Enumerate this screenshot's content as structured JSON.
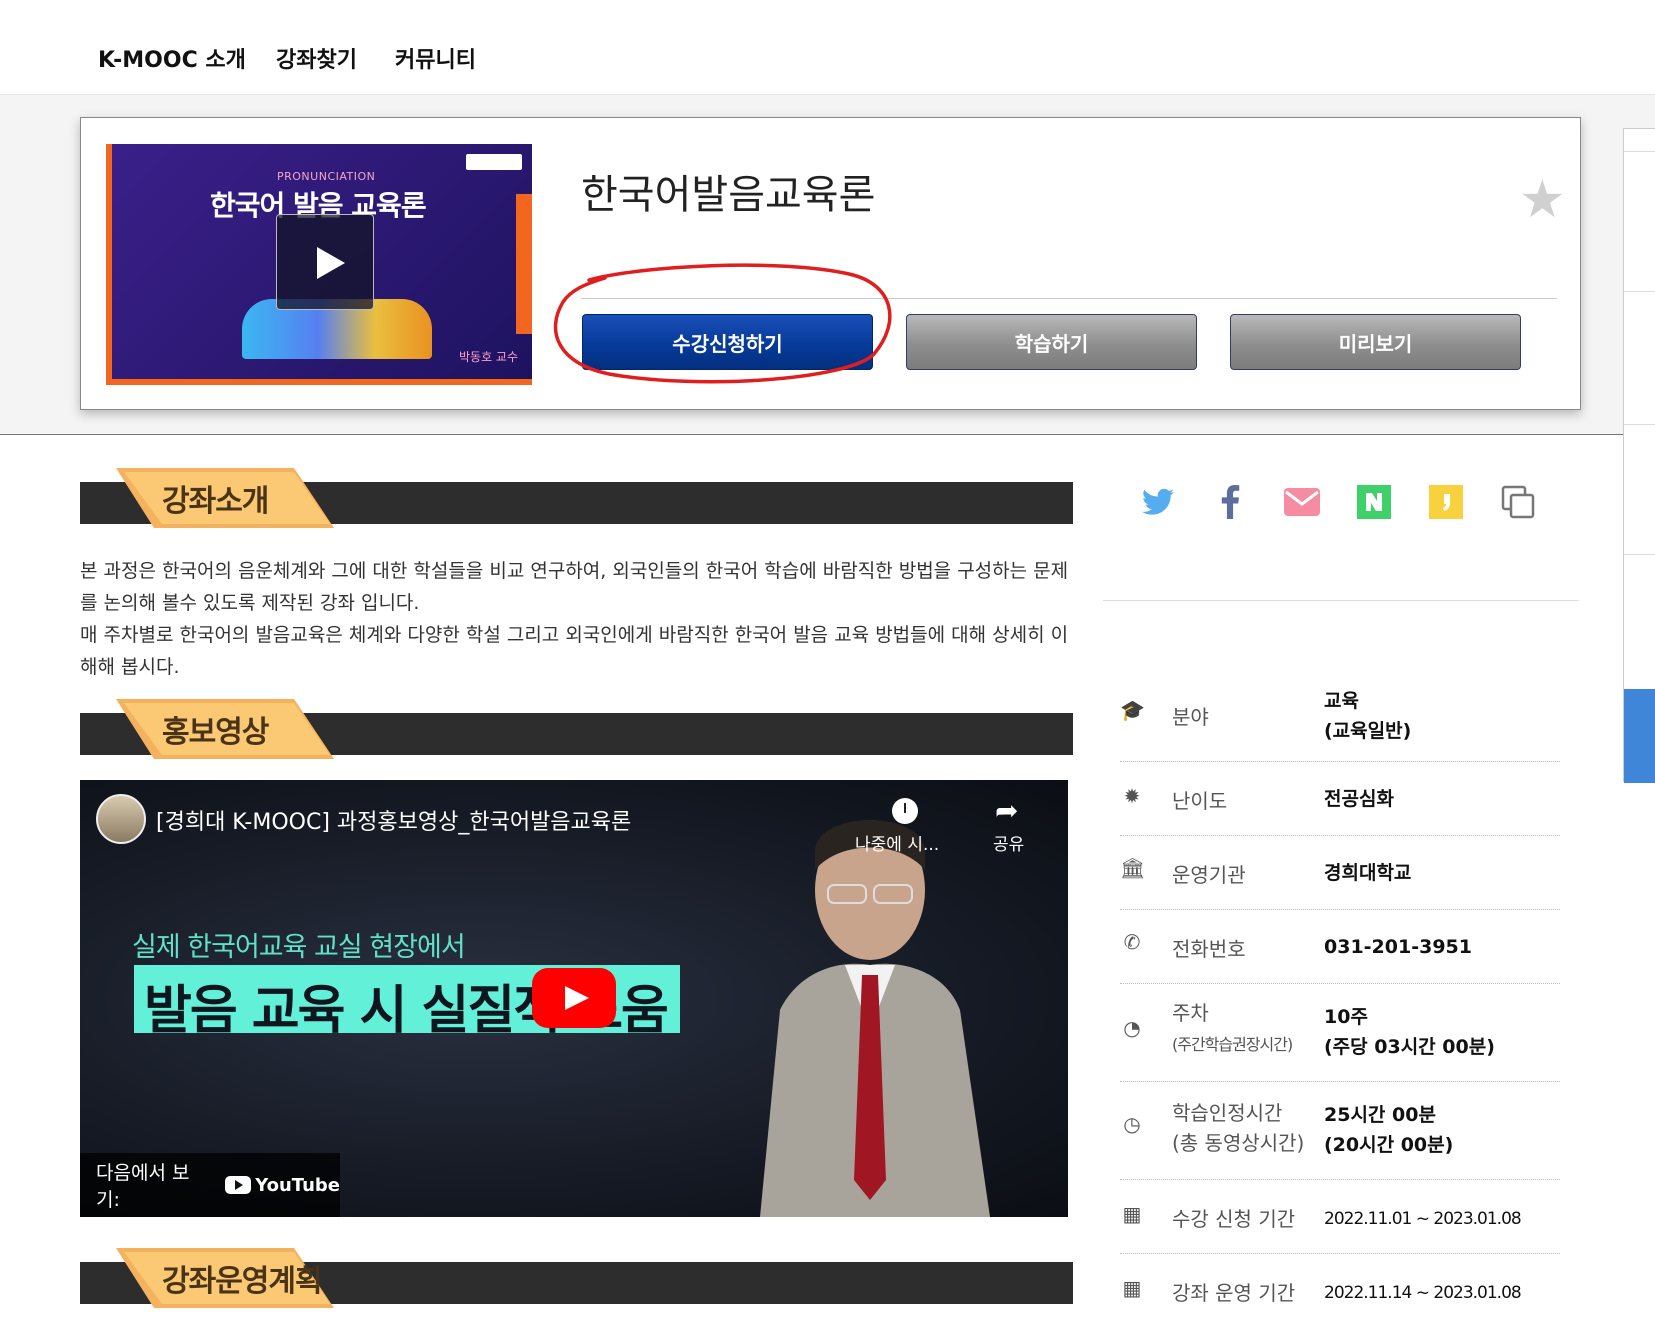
{
  "nav": {
    "items": [
      "K-MOOC 소개",
      "강좌찾기",
      "커뮤니티"
    ]
  },
  "course": {
    "title": "한국어발음교육론",
    "thumbnail": {
      "subtitle": "PRONUNCIATION",
      "title": "한국어 발음 교육론",
      "professor": "박동호 교수"
    },
    "buttons": {
      "enroll": "수강신청하기",
      "study": "학습하기",
      "preview": "미리보기"
    }
  },
  "sections": {
    "intro": "강좌소개",
    "promo": "홍보영상",
    "plan": "강좌운영계획"
  },
  "description": [
    "본 과정은 한국어의 음운체계와 그에 대한 학설들을 비교 연구하여, 외국인들의 한국어 학습에 바람직한 방법을 구성하는 문제를 논의해 볼수 있도록 제작된 강좌 입니다.",
    "매 주차별로 한국어의 발음교육은 체계와 다양한 학설 그리고 외국인에게 바람직한 한국어 발음 교육 방법들에 대해 상세히 이해해 봅시다."
  ],
  "video": {
    "title": "[경희대 K-MOOC] 과정홍보영상_한국어발음교육론",
    "watch_later": "나중에 시...",
    "share": "공유",
    "subline": "실제 한국어교육 교실 현장에서",
    "headline": "발음 교육 시 실질적 도움",
    "watch_on": "다음에서 보기:",
    "youtube": "YouTube"
  },
  "info": {
    "field": {
      "label": "분야",
      "value1": "교육",
      "value2": "(교육일반)",
      "icon": "graduation-cap-icon"
    },
    "difficulty": {
      "label": "난이도",
      "value": "전공심화",
      "icon": "gear-badge-icon"
    },
    "org": {
      "label": "운영기관",
      "value": "경희대학교",
      "icon": "institution-icon"
    },
    "phone": {
      "label": "전화번호",
      "value": "031-201-3951",
      "icon": "phone-icon"
    },
    "weeks": {
      "label": "주차",
      "label2": "(주간학습권장시간)",
      "value1": "10주",
      "value2": "(주당 03시간 00분)",
      "icon": "dashboard-icon"
    },
    "hours": {
      "label": "학습인정시간",
      "label2": "(총 동영상시간)",
      "value1": "25시간 00분",
      "value2": "(20시간 00분)",
      "icon": "clock-icon"
    },
    "enroll_period": {
      "label": "수강 신청 기간",
      "value": "2022.11.01 ~ 2023.01.08",
      "icon": "calendar-icon"
    },
    "run_period": {
      "label": "강좌 운영 기간",
      "value": "2022.11.14 ~ 2023.01.08",
      "icon": "calendar-icon"
    }
  },
  "colors": {
    "enroll_button": "#063a9a",
    "twitter": "#55acee",
    "facebook": "#3b5998",
    "naver": "#2db400",
    "kakao": "#f7d23e",
    "mail": "#f58ca2",
    "annotation": "#e01e1e"
  }
}
